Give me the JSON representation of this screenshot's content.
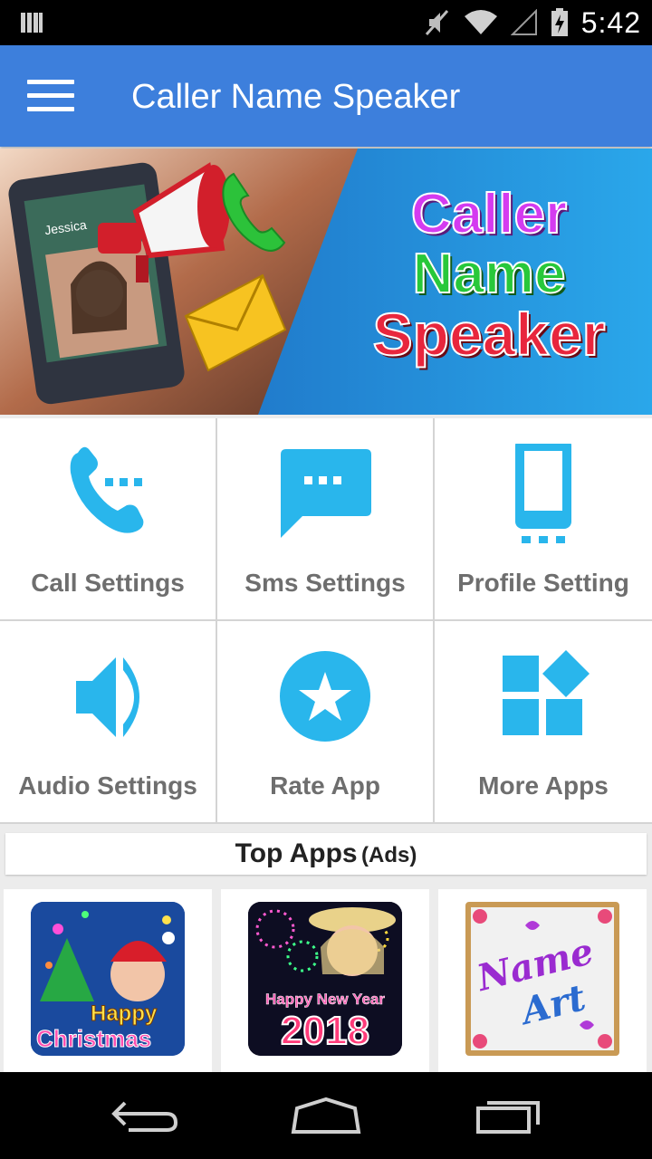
{
  "status_bar": {
    "time": "5:42",
    "icons": [
      "notification-icon",
      "mute-icon",
      "wifi-icon",
      "signal-icon",
      "battery-icon"
    ]
  },
  "toolbar": {
    "title": "Caller Name Speaker",
    "menu_icon": "hamburger-menu-icon"
  },
  "banner": {
    "line1": "Caller",
    "line2": "Name",
    "line3": "Speaker",
    "phone_caller": "Jessica",
    "colors": {
      "line1": "#d43bf0",
      "line2": "#28c83a",
      "line3": "#e8263d"
    }
  },
  "menu": {
    "items": [
      {
        "label": "Call Settings",
        "icon": "phone-call-icon"
      },
      {
        "label": "Sms Settings",
        "icon": "chat-bubble-icon"
      },
      {
        "label": "Profile Setting",
        "icon": "smartphone-icon"
      },
      {
        "label": "Audio Settings",
        "icon": "speaker-volume-icon"
      },
      {
        "label": "Rate App",
        "icon": "star-icon"
      },
      {
        "label": "More Apps",
        "icon": "apps-grid-icon"
      }
    ],
    "icon_color": "#29b6ec"
  },
  "top_apps": {
    "title": "Top Apps",
    "suffix": "(Ads)",
    "apps": [
      {
        "caption_1": "Happy",
        "caption_2": "Christmas"
      },
      {
        "caption_1": "Happy New Year",
        "caption_2": "2018"
      },
      {
        "caption_1": "Name",
        "caption_2": "Art"
      }
    ]
  },
  "nav_bar": {
    "icons": [
      "back-icon",
      "home-icon",
      "recent-apps-icon"
    ]
  }
}
